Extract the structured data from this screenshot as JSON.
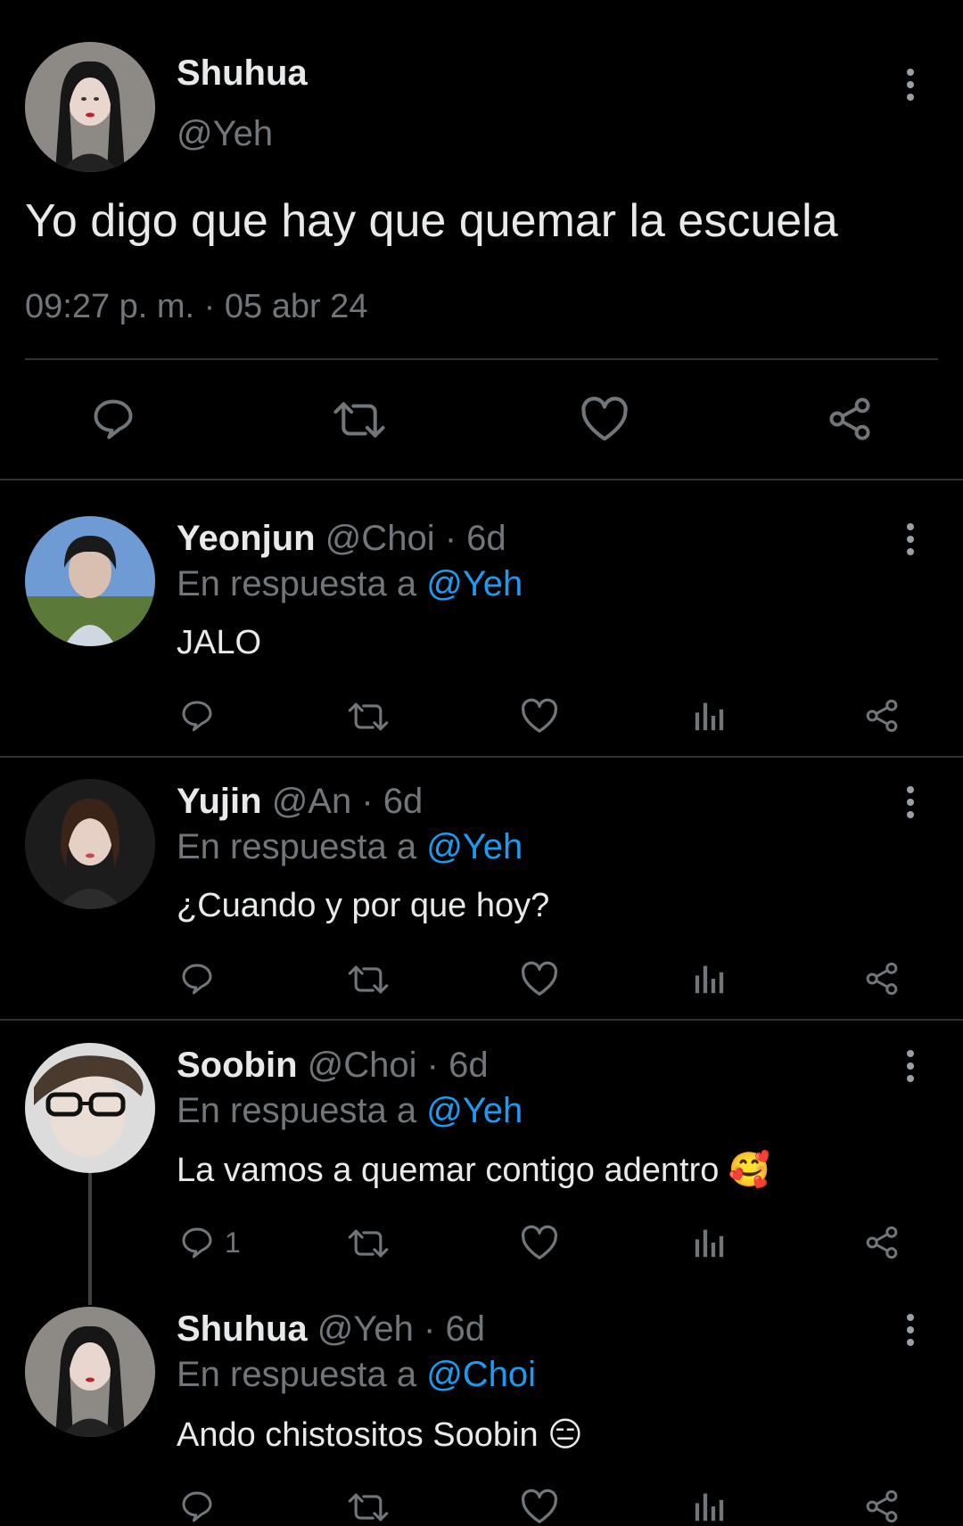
{
  "main_tweet": {
    "author_name": "Shuhua",
    "author_handle": "@Yeh",
    "text": "Yo digo que hay que quemar la escuela",
    "timestamp": "09:27 p. m. · 05 abr 24",
    "actions": [
      "reply-icon",
      "retweet-icon",
      "like-icon",
      "share-icon"
    ]
  },
  "replies": [
    {
      "name": "Yeonjun",
      "handle_time": "@Choi · 6d",
      "reply_prefix": "En respuesta a",
      "reply_to": "@Yeh",
      "text": "JALO",
      "reply_count": ""
    },
    {
      "name": "Yujin",
      "handle_time": "@An · 6d",
      "reply_prefix": "En respuesta a",
      "reply_to": "@Yeh",
      "text": "¿Cuando y por que hoy?",
      "reply_count": ""
    },
    {
      "name": "Soobin",
      "handle_time": "@Choi · 6d",
      "reply_prefix": "En respuesta a",
      "reply_to": "@Yeh",
      "text": "La vamos a quemar contigo adentro 🥰",
      "reply_count": "1"
    },
    {
      "name": "Shuhua",
      "handle_time": "@Yeh · 6d",
      "reply_prefix": "En respuesta a",
      "reply_to": "@Choi",
      "text": "Ando chistositos Soobin 😑",
      "reply_count": ""
    }
  ],
  "colors": {
    "background": "#000000",
    "text": "#e7e9ea",
    "muted": "#71767b",
    "link": "#1d9bf0",
    "divider": "#2f3336"
  }
}
